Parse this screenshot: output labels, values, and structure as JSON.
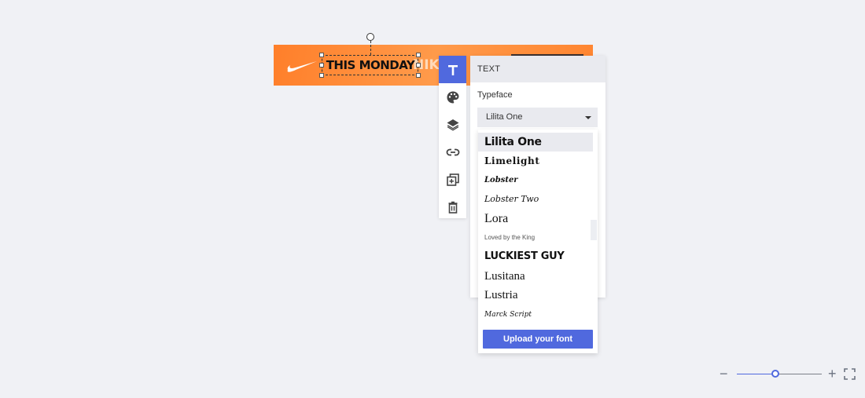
{
  "canvas": {
    "banner": {
      "headline": "THIS MONDAY",
      "ghost_text": "NIKE",
      "logo": "swoosh-icon",
      "brand_color": "#ff8a3a"
    }
  },
  "toolbar": {
    "accent": "#5069de",
    "items": [
      {
        "icon": "text-icon",
        "label": "Text",
        "active": true
      },
      {
        "icon": "palette-icon",
        "label": "Color"
      },
      {
        "icon": "layers-icon",
        "label": "Layers"
      },
      {
        "icon": "link-icon",
        "label": "Link"
      },
      {
        "icon": "duplicate-icon",
        "label": "Duplicate"
      },
      {
        "icon": "trash-icon",
        "label": "Delete"
      }
    ]
  },
  "panel": {
    "title": "TEXT",
    "typeface_label": "Typeface",
    "typeface_value": "Lilita One"
  },
  "font_dropdown": {
    "fonts": [
      {
        "name": "Lilita One",
        "selected": true
      },
      {
        "name": "Limelight"
      },
      {
        "name": "Lobster"
      },
      {
        "name": "Lobster Two"
      },
      {
        "name": "Lora"
      },
      {
        "name": "Loved by the King"
      },
      {
        "name": "Luckiest Guy"
      },
      {
        "name": "Lusitana"
      },
      {
        "name": "Lustria"
      },
      {
        "name": "Marck Script"
      }
    ],
    "upload_label": "Upload your font"
  },
  "zoom": {
    "minus_label": "−",
    "plus_label": "+",
    "level_fraction": 0.45
  }
}
